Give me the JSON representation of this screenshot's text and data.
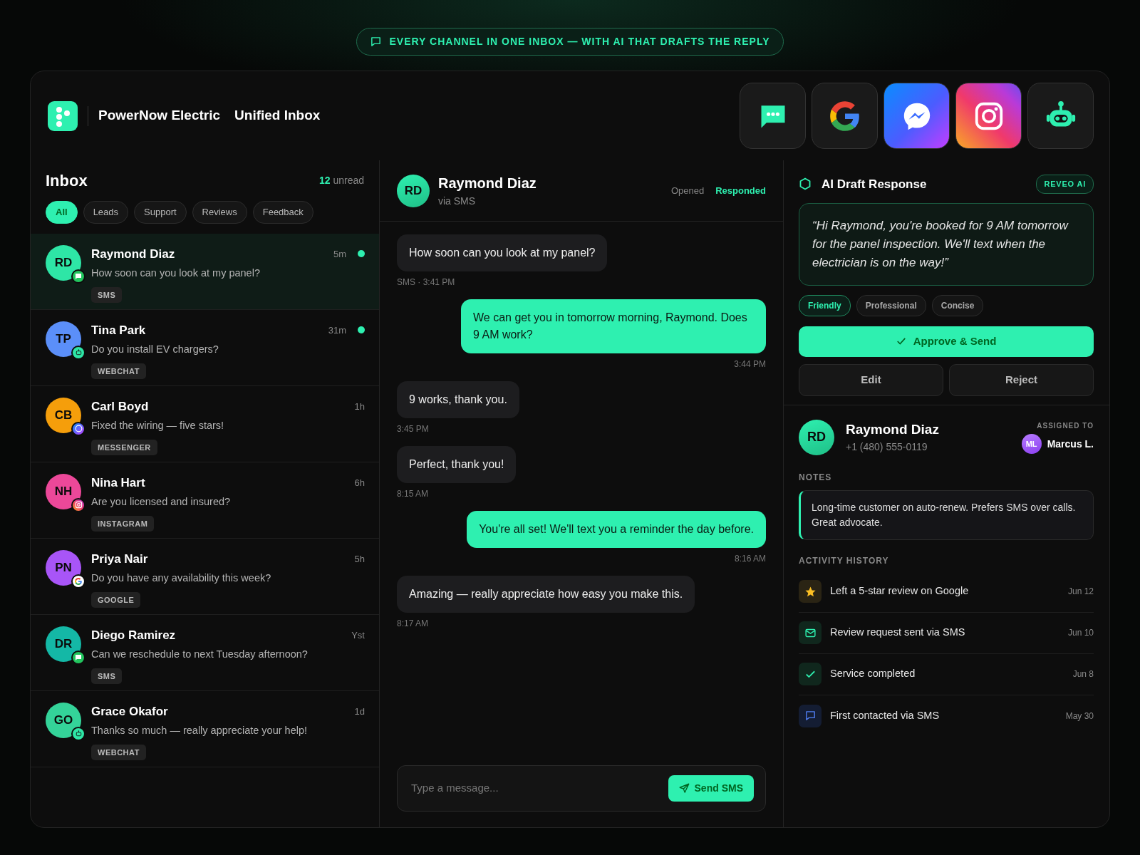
{
  "banner": {
    "text": "EVERY CHANNEL IN ONE INBOX — WITH AI THAT DRAFTS THE REPLY"
  },
  "header": {
    "brand": "PowerNow Electric",
    "title": "Unified Inbox"
  },
  "channels": [
    {
      "kind": "sms"
    },
    {
      "kind": "google"
    },
    {
      "kind": "messenger"
    },
    {
      "kind": "instagram"
    },
    {
      "kind": "bot"
    }
  ],
  "inbox": {
    "title": "Inbox",
    "unread_count": "12",
    "unread_label": "unread",
    "filters": [
      {
        "label": "All",
        "selected": true
      },
      {
        "label": "Leads",
        "selected": false
      },
      {
        "label": "Support",
        "selected": false
      },
      {
        "label": "Reviews",
        "selected": false
      },
      {
        "label": "Feedback",
        "selected": false
      }
    ],
    "conversations": [
      {
        "initials": "RD",
        "color": "#2ee6a6",
        "kind": "sms",
        "name": "Raymond Diaz",
        "time": "5m",
        "preview": "How soon can you look at my panel?",
        "tag": "SMS",
        "unread": true,
        "selected": true
      },
      {
        "initials": "TP",
        "color": "#5b8ff9",
        "kind": "bot",
        "name": "Tina Park",
        "time": "31m",
        "preview": "Do you install EV chargers?",
        "tag": "WEBCHAT",
        "unread": true,
        "selected": false
      },
      {
        "initials": "CB",
        "color": "#f59e0b",
        "kind": "messenger",
        "name": "Carl Boyd",
        "time": "1h",
        "preview": "Fixed the wiring — five stars!",
        "tag": "MESSENGER",
        "unread": false,
        "selected": false
      },
      {
        "initials": "NH",
        "color": "#ec4899",
        "kind": "instagram",
        "name": "Nina Hart",
        "time": "6h",
        "preview": "Are you licensed and insured?",
        "tag": "INSTAGRAM",
        "unread": false,
        "selected": false
      },
      {
        "initials": "PN",
        "color": "#a855f7",
        "kind": "google",
        "name": "Priya Nair",
        "time": "5h",
        "preview": "Do you have any availability this week?",
        "tag": "GOOGLE",
        "unread": false,
        "selected": false
      },
      {
        "initials": "DR",
        "color": "#14b8a6",
        "kind": "sms",
        "name": "Diego Ramirez",
        "time": "Yst",
        "preview": "Can we reschedule to next Tuesday afternoon?",
        "tag": "SMS",
        "unread": false,
        "selected": false
      },
      {
        "initials": "GO",
        "color": "#34d399",
        "kind": "bot",
        "name": "Grace Okafor",
        "time": "1d",
        "preview": "Thanks so much — really appreciate your help!",
        "tag": "WEBCHAT",
        "unread": false,
        "selected": false
      }
    ]
  },
  "chat": {
    "initials": "RD",
    "name": "Raymond Diaz",
    "via": "via SMS",
    "statuses": [
      {
        "label": "Opened",
        "active": false
      },
      {
        "label": "Responded",
        "active": true
      }
    ],
    "messages": [
      {
        "kind": "in",
        "text": "How soon can you look at my panel?",
        "meta": "SMS · 3:41 PM"
      },
      {
        "kind": "out",
        "text": "We can get you in tomorrow morning, Raymond. Does 9 AM work?",
        "meta": "3:44 PM"
      },
      {
        "kind": "in",
        "text": "9 works, thank you.",
        "meta": "3:45 PM"
      },
      {
        "kind": "in",
        "text": "Perfect, thank you!",
        "meta": "8:15 AM"
      },
      {
        "kind": "out",
        "text": "You're all set! We'll text you a reminder the day before.",
        "meta": "8:16 AM"
      },
      {
        "kind": "in",
        "text": "Amazing — really appreciate how easy you make this.",
        "meta": "8:17 AM"
      }
    ],
    "composer": {
      "placeholder": "Type a message...",
      "send": "Send SMS"
    }
  },
  "ai": {
    "title": "AI Draft Response",
    "badge": "REVEO AI",
    "draft": "“Hi Raymond, you're booked for 9 AM tomorrow for the panel inspection. We'll text when the electrician is on the way!”",
    "tones": [
      {
        "label": "Friendly",
        "selected": true
      },
      {
        "label": "Professional",
        "selected": false
      },
      {
        "label": "Concise",
        "selected": false
      }
    ],
    "approve": "Approve & Send",
    "edit": "Edit",
    "reject": "Reject"
  },
  "contact": {
    "initials": "RD",
    "name": "Raymond Diaz",
    "phone": "+1 (480) 555-0119",
    "assigned_label": "ASSIGNED TO",
    "assignee_initials": "ML",
    "assignee": "Marcus L.",
    "notes_label": "NOTES",
    "notes": "Long-time customer on auto-renew. Prefers SMS over calls. Great advocate.",
    "activity_label": "ACTIVITY HISTORY",
    "activity": [
      {
        "kind": "star",
        "text": "Left a 5-star review on Google",
        "date": "Jun 12"
      },
      {
        "kind": "mail",
        "text": "Review request sent via SMS",
        "date": "Jun 10"
      },
      {
        "kind": "check",
        "text": "Service completed",
        "date": "Jun 8"
      },
      {
        "kind": "chat",
        "text": "First contacted via SMS",
        "date": "May 30"
      }
    ]
  }
}
